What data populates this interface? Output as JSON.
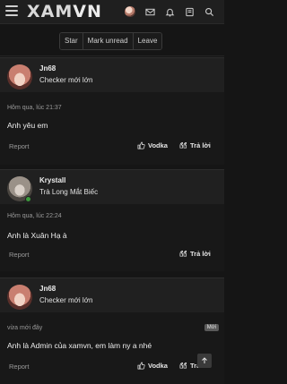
{
  "header": {
    "logo_part1": "XAM",
    "logo_part2": "VN",
    "icons": [
      "menu-icon",
      "avatar",
      "mail-icon",
      "bell-icon",
      "bookmark-icon",
      "search-icon"
    ]
  },
  "actions": {
    "star": "Star",
    "mark_unread": "Mark unread",
    "leave": "Leave"
  },
  "posts": [
    {
      "username": "Jn68",
      "user_title": "Checker mới lớn",
      "timestamp": "Hôm qua, lúc 21:37",
      "content": "Anh yêu em",
      "report": "Report",
      "reaction": "Vodka",
      "reply": "Trả lời"
    },
    {
      "username": "Krystall",
      "user_title": "Trà Long Mắt Biếc",
      "timestamp": "Hôm qua, lúc 22:24",
      "content": "Anh là Xuân Hạ à",
      "report": "Report",
      "reply": "Trả lời"
    },
    {
      "username": "Jn68",
      "user_title": "Checker mới lớn",
      "timestamp": "vừa mới đây",
      "badge": "Mới",
      "content": "Anh là Admin của xamvn, em làm ny a nhé",
      "report": "Report",
      "reaction": "Vodka",
      "reply": "Trả lời"
    }
  ]
}
